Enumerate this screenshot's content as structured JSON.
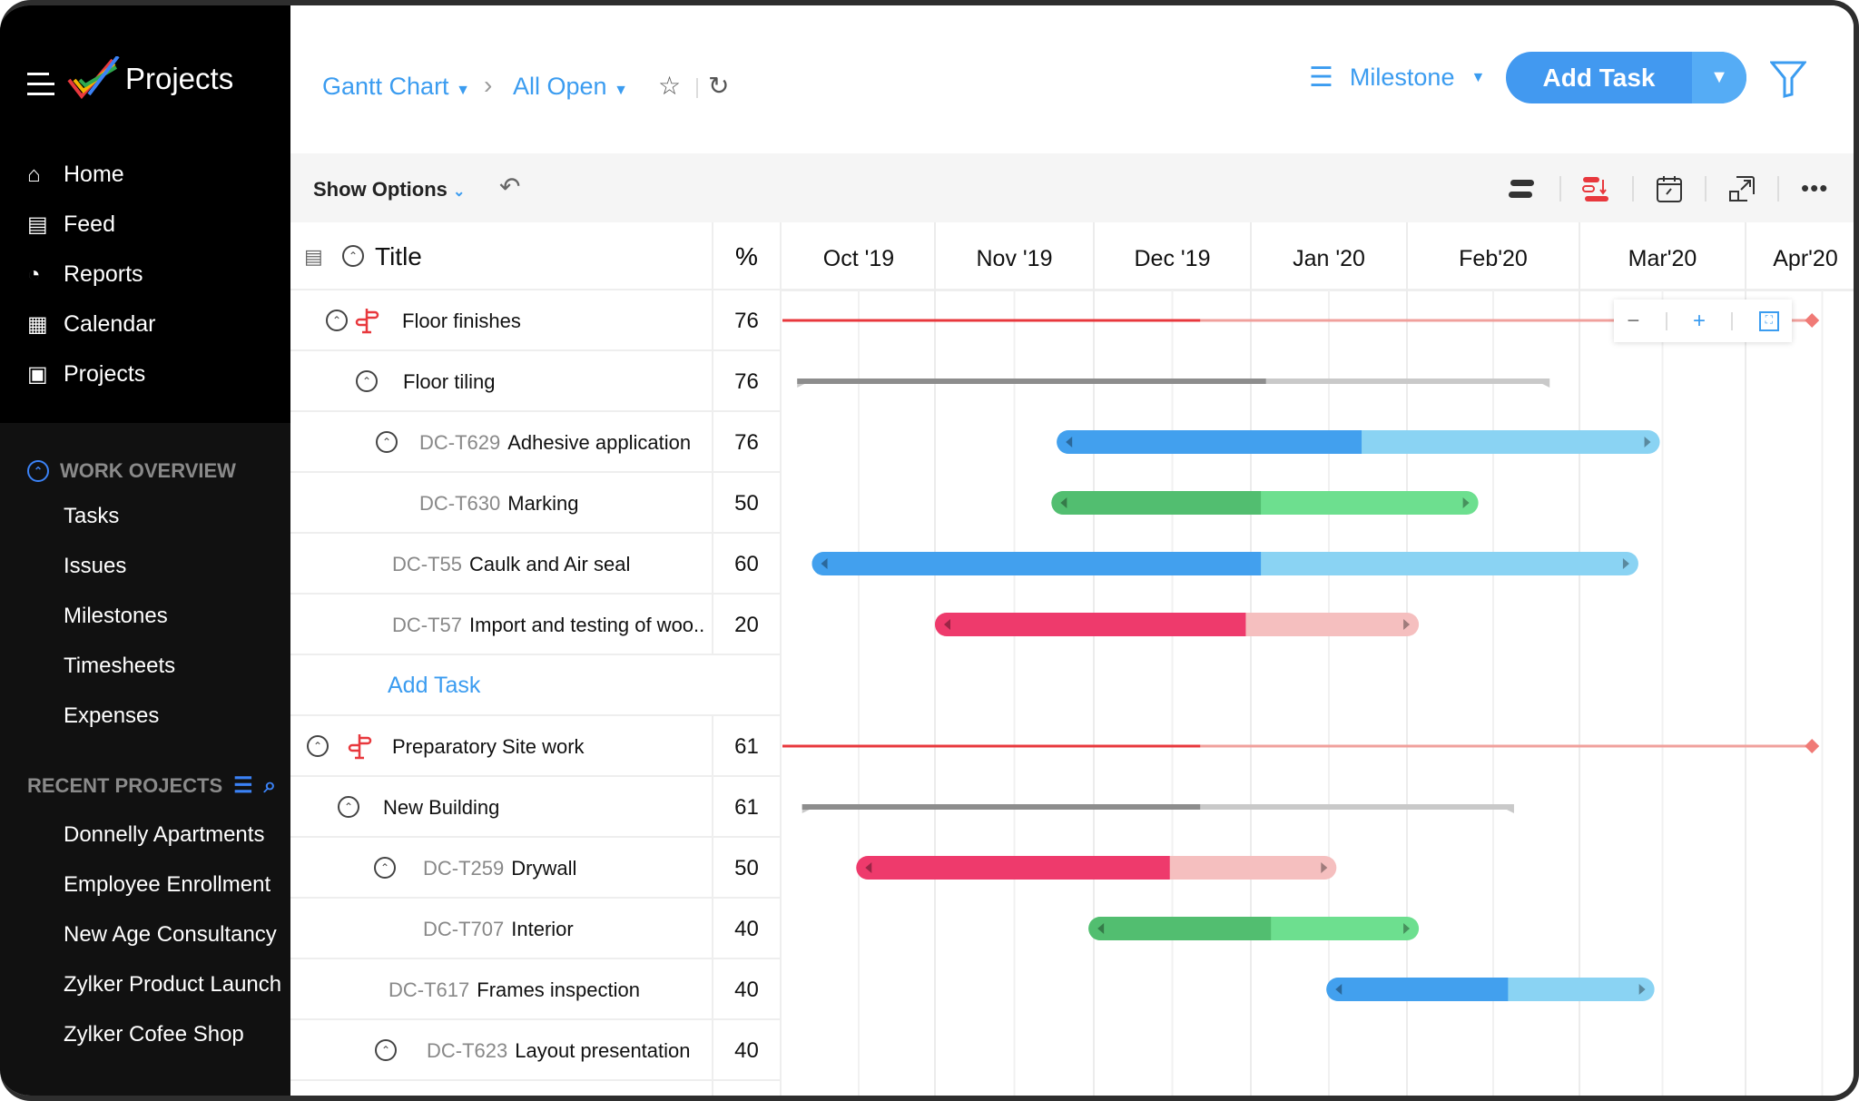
{
  "app": {
    "name": "Projects"
  },
  "sidebar": {
    "nav": [
      {
        "label": "Home",
        "icon": "home-icon"
      },
      {
        "label": "Feed",
        "icon": "feed-icon"
      },
      {
        "label": "Reports",
        "icon": "reports-icon"
      },
      {
        "label": "Calendar",
        "icon": "calendar-icon"
      },
      {
        "label": "Projects",
        "icon": "projects-icon"
      }
    ],
    "work_overview": {
      "title": "WORK OVERVIEW",
      "items": [
        "Tasks",
        "Issues",
        "Milestones",
        "Timesheets",
        "Expenses"
      ]
    },
    "recent_projects": {
      "title": "RECENT PROJECTS",
      "items": [
        "Donnelly Apartments",
        "Employee Enrollment",
        "New Age Consultancy",
        "Zylker Product Launch",
        "Zylker Cofee Shop"
      ]
    }
  },
  "header": {
    "view": "Gantt Chart",
    "filter": "All Open",
    "milestone": "Milestone",
    "add_task": "Add Task"
  },
  "toolbar": {
    "show_options": "Show Options"
  },
  "columns": {
    "title": "Title",
    "percent": "%"
  },
  "months": [
    "Oct '19",
    "Nov '19",
    "Dec '19",
    "Jan '20",
    "Feb'20",
    "Mar'20",
    "Apr'20"
  ],
  "add_task_link": "Add Task",
  "colors": {
    "accent": "#3b9cf0",
    "milestone": "#e8383d",
    "blue": "#42a0ee",
    "blue_light": "#8ad3f3",
    "green": "#52be70",
    "green_light": "#6ddf8f",
    "red": "#ee3a6c",
    "red_light": "#f5bfbf",
    "gray": "#8d8d8d",
    "gray_light": "#c9c9c9"
  },
  "rows": [
    {
      "kind": "milestone",
      "title": "Floor finishes",
      "percent": "76",
      "bar": {
        "type": "milestone",
        "start": "2019-10-01",
        "end": "2020-04-14",
        "progress_to": "2019-12-22"
      }
    },
    {
      "kind": "group",
      "title": "Floor tiling",
      "percent": "76",
      "bar": {
        "type": "summary",
        "start": "2019-10-04",
        "end": "2020-02-25",
        "progress_to": "2020-01-04"
      }
    },
    {
      "kind": "task",
      "id": "DC-T629",
      "title": "Adhesive application",
      "percent": "76",
      "collapsible": true,
      "bar": {
        "type": "task",
        "color": "blue",
        "start": "2019-11-24",
        "end": "2020-03-16",
        "progress_to": "2020-01-23"
      }
    },
    {
      "kind": "task",
      "id": "DC-T630",
      "title": "Marking",
      "percent": "50",
      "bar": {
        "type": "task",
        "color": "green",
        "start": "2019-11-23",
        "end": "2020-02-13",
        "progress_to": "2020-01-03"
      }
    },
    {
      "kind": "task",
      "id": "DC-T55",
      "title": "Caulk and Air seal",
      "percent": "60",
      "bar": {
        "type": "task",
        "color": "blue",
        "start": "2019-10-07",
        "end": "2020-03-12",
        "progress_to": "2020-01-03"
      }
    },
    {
      "kind": "task",
      "id": "DC-T57",
      "title": "Import and testing of woo..",
      "percent": "20",
      "bar": {
        "type": "task",
        "color": "red",
        "start": "2019-11-01",
        "end": "2020-02-03",
        "progress_to": "2019-12-31"
      }
    },
    {
      "kind": "add"
    },
    {
      "kind": "milestone",
      "title": "Preparatory Site work",
      "percent": "61",
      "collapsible": true,
      "bar": {
        "type": "milestone",
        "start": "2019-10-01",
        "end": "2020-04-14",
        "progress_to": "2019-12-22"
      }
    },
    {
      "kind": "group",
      "title": "New Building",
      "percent": "61",
      "bar": {
        "type": "summary",
        "start": "2019-10-05",
        "end": "2020-02-19",
        "progress_to": "2019-12-22"
      }
    },
    {
      "kind": "task",
      "id": "DC-T259",
      "title": "Drywall",
      "percent": "50",
      "collapsible": true,
      "bar": {
        "type": "task",
        "color": "red",
        "start": "2019-10-16",
        "end": "2020-01-18",
        "progress_to": "2019-12-16"
      }
    },
    {
      "kind": "task",
      "id": "DC-T707",
      "title": "Interior",
      "percent": "40",
      "bar": {
        "type": "task",
        "color": "green",
        "start": "2019-11-30",
        "end": "2020-02-03",
        "progress_to": "2020-01-05"
      }
    },
    {
      "kind": "task",
      "id": "DC-T617",
      "title": "Frames inspection",
      "percent": "40",
      "bar": {
        "type": "task",
        "color": "blue",
        "start": "2020-01-16",
        "end": "2020-03-15",
        "progress_to": "2020-02-18"
      }
    },
    {
      "kind": "task",
      "id": "DC-T623",
      "title": "Layout presentation",
      "percent": "40",
      "collapsible": true
    }
  ]
}
